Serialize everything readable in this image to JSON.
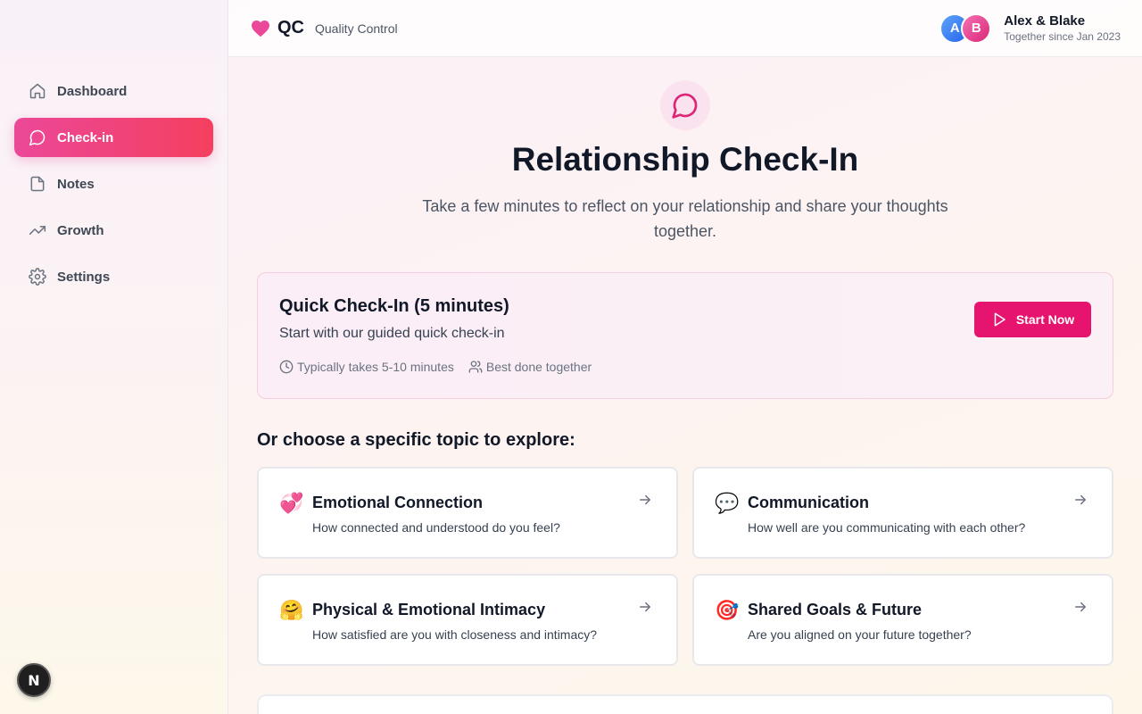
{
  "brand": {
    "logo_text": "QC",
    "tagline": "Quality Control",
    "icon": "heart-icon"
  },
  "user": {
    "avatar_a": "A",
    "avatar_b": "B",
    "name": "Alex & Blake",
    "since": "Together since Jan 2023"
  },
  "sidebar": {
    "items": [
      {
        "label": "Dashboard",
        "icon": "home-icon",
        "active": false
      },
      {
        "label": "Check-in",
        "icon": "message-circle-icon",
        "active": true
      },
      {
        "label": "Notes",
        "icon": "file-icon",
        "active": false
      },
      {
        "label": "Growth",
        "icon": "trending-up-icon",
        "active": false
      },
      {
        "label": "Settings",
        "icon": "gear-icon",
        "active": false
      }
    ],
    "badge": "N"
  },
  "hero": {
    "icon": "message-circle-icon",
    "title": "Relationship Check-In",
    "subtitle": "Take a few minutes to reflect on your relationship and share your thoughts together."
  },
  "quick": {
    "title": "Quick Check-In (5 minutes)",
    "description": "Start with our guided quick check-in",
    "duration": "Typically takes 5-10 minutes",
    "together": "Best done together",
    "button": "Start Now"
  },
  "topics": {
    "heading": "Or choose a specific topic to explore:",
    "items": [
      {
        "emoji": "💞",
        "title": "Emotional Connection",
        "description": "How connected and understood do you feel?"
      },
      {
        "emoji": "💬",
        "title": "Communication",
        "description": "How well are you communicating with each other?"
      },
      {
        "emoji": "🤗",
        "title": "Physical & Emotional Intimacy",
        "description": "How satisfied are you with closeness and intimacy?"
      },
      {
        "emoji": "🎯",
        "title": "Shared Goals & Future",
        "description": "Are you aligned on your future together?"
      }
    ]
  },
  "colors": {
    "accent": "#e6136f",
    "accent_gradient_start": "#ec4899",
    "accent_gradient_end": "#f43f5e"
  }
}
